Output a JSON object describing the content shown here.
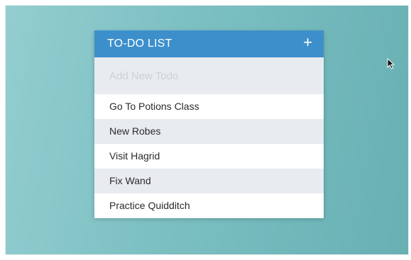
{
  "todo": {
    "title": "TO-DO LIST",
    "add_icon": "plus-icon",
    "add_symbol": "+",
    "input_placeholder": "Add New Todo",
    "input_value": "",
    "items": [
      "Go To Potions Class",
      "New Robes",
      "Visit Hagrid",
      "Fix Wand",
      "Practice Quidditch"
    ]
  },
  "cursor": {
    "icon": "mouse-pointer-icon"
  },
  "colors": {
    "header": "#3d8fcc",
    "input_bg": "#e8ebef",
    "row_alt": "#e8ebef",
    "row": "#ffffff",
    "background_start": "#93cdd0",
    "background_end": "#68b0b4"
  }
}
